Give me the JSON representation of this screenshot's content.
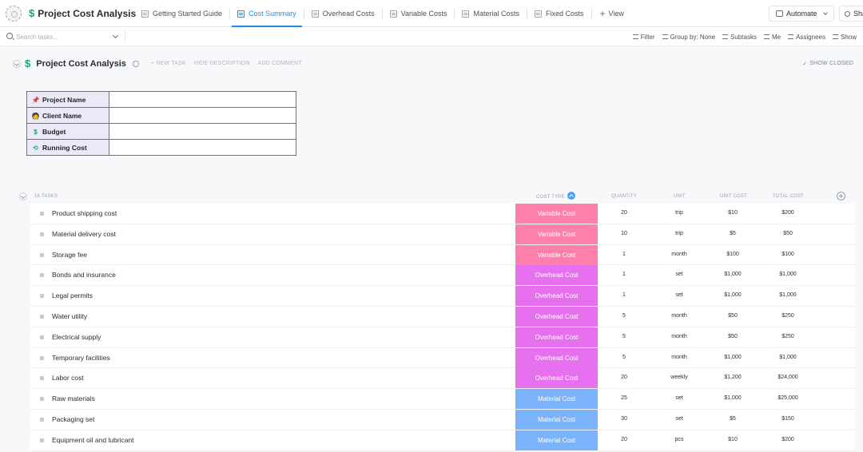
{
  "app": {
    "title": "Project Cost Analysis"
  },
  "tabs": [
    {
      "label": "Getting Started Guide",
      "active": false
    },
    {
      "label": "Cost Summary",
      "active": true
    },
    {
      "label": "Overhead Costs",
      "active": false
    },
    {
      "label": "Variable Costs",
      "active": false
    },
    {
      "label": "Material Costs",
      "active": false
    },
    {
      "label": "Fixed Costs",
      "active": false
    }
  ],
  "add_view_label": "View",
  "automate_label": "Automate",
  "share_label": "Sha",
  "toolbar": {
    "search_placeholder": "Search tasks...",
    "filter": "Filter",
    "group_by": "Group by: None",
    "subtasks": "Subtasks",
    "me": "Me",
    "assignees": "Assignees",
    "show": "Show"
  },
  "list": {
    "title": "Project Cost Analysis",
    "actions": [
      "+ NEW TASK",
      "HIDE DESCRIPTION",
      "ADD COMMENT"
    ],
    "show_closed": "SHOW CLOSED"
  },
  "description_table": [
    {
      "icon": "📌",
      "icon_name": "pushpin-icon",
      "label": "Project Name",
      "value": ""
    },
    {
      "icon": "🧑",
      "icon_name": "person-icon",
      "label": "Client Name",
      "value": ""
    },
    {
      "icon": "$",
      "icon_name": "dollar-icon",
      "label": "Budget",
      "value": ""
    },
    {
      "icon": "⟲",
      "icon_name": "cycle-icon",
      "label": "Running Cost",
      "value": ""
    }
  ],
  "group": {
    "task_count": "16 TASKS"
  },
  "columns": {
    "cost_type": "COST TYPE",
    "quantity": "QUANTITY",
    "unit": "UNIT",
    "unit_cost": "UNIT COST",
    "total_cost": "TOTAL COST"
  },
  "cost_type_colors": {
    "Variable Cost": "#ff7fab",
    "Overhead Cost": "#e770ef",
    "Material Cost": "#7ab3fb"
  },
  "tasks": [
    {
      "name": "Product shipping cost",
      "cost_type": "Variable Cost",
      "quantity": "20",
      "unit": "trip",
      "unit_cost": "$10",
      "total_cost": "$200"
    },
    {
      "name": "Material delivery cost",
      "cost_type": "Variable Cost",
      "quantity": "10",
      "unit": "trip",
      "unit_cost": "$5",
      "total_cost": "$50"
    },
    {
      "name": "Storage fee",
      "cost_type": "Variable Cost",
      "quantity": "1",
      "unit": "month",
      "unit_cost": "$100",
      "total_cost": "$100"
    },
    {
      "name": "Bonds and insurance",
      "cost_type": "Overhead Cost",
      "quantity": "1",
      "unit": "set",
      "unit_cost": "$1,000",
      "total_cost": "$1,000"
    },
    {
      "name": "Legal permits",
      "cost_type": "Overhead Cost",
      "quantity": "1",
      "unit": "set",
      "unit_cost": "$1,000",
      "total_cost": "$1,000"
    },
    {
      "name": "Water utility",
      "cost_type": "Overhead Cost",
      "quantity": "5",
      "unit": "month",
      "unit_cost": "$50",
      "total_cost": "$250"
    },
    {
      "name": "Electrical supply",
      "cost_type": "Overhead Cost",
      "quantity": "5",
      "unit": "month",
      "unit_cost": "$50",
      "total_cost": "$250"
    },
    {
      "name": "Temporary facilities",
      "cost_type": "Overhead Cost",
      "quantity": "5",
      "unit": "month",
      "unit_cost": "$1,000",
      "total_cost": "$1,000"
    },
    {
      "name": "Labor cost",
      "cost_type": "Overhead Cost",
      "quantity": "20",
      "unit": "weekly",
      "unit_cost": "$1,200",
      "total_cost": "$24,000"
    },
    {
      "name": "Raw materials",
      "cost_type": "Material Cost",
      "quantity": "25",
      "unit": "set",
      "unit_cost": "$1,000",
      "total_cost": "$25,000"
    },
    {
      "name": "Packaging set",
      "cost_type": "Material Cost",
      "quantity": "30",
      "unit": "set",
      "unit_cost": "$5",
      "total_cost": "$150"
    },
    {
      "name": "Equipment oil and lubricant",
      "cost_type": "Material Cost",
      "quantity": "20",
      "unit": "pcs",
      "unit_cost": "$10",
      "total_cost": "$200"
    }
  ]
}
